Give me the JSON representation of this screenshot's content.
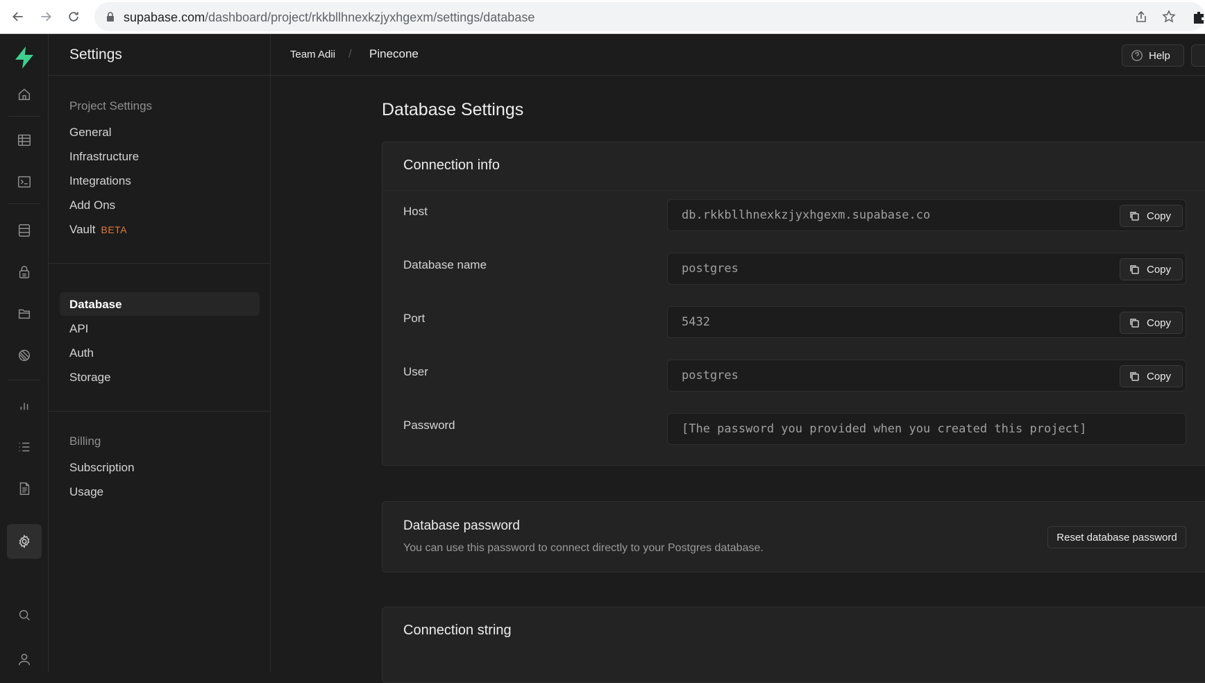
{
  "browser": {
    "url_domain": "supabase.com",
    "url_path": "/dashboard/project/rkkbllhnexkzjyxhgexm/settings/database"
  },
  "header": {
    "section_title": "Settings",
    "breadcrumb_team": "Team Adii",
    "breadcrumb_separator": "/",
    "breadcrumb_project": "Pinecone",
    "help_label": "Help"
  },
  "rail": {
    "items": [
      "home-icon",
      "table-editor-icon",
      "sql-editor-icon",
      "database-icon",
      "auth-icon",
      "storage-icon",
      "edge-functions-icon",
      "reports-icon",
      "logs-icon",
      "api-docs-icon",
      "settings-icon",
      "search-icon",
      "user-icon"
    ],
    "brand_color": "#3ecf8e"
  },
  "menu": {
    "project_settings_title": "Project Settings",
    "project_items": [
      {
        "label": "General"
      },
      {
        "label": "Infrastructure"
      },
      {
        "label": "Integrations"
      },
      {
        "label": "Add Ons"
      },
      {
        "label": "Vault",
        "badge": "BETA"
      }
    ],
    "config_items": [
      {
        "label": "Database",
        "active": true
      },
      {
        "label": "API"
      },
      {
        "label": "Auth"
      },
      {
        "label": "Storage"
      }
    ],
    "billing_title": "Billing",
    "billing_items": [
      {
        "label": "Subscription"
      },
      {
        "label": "Usage"
      }
    ]
  },
  "main": {
    "page_title": "Database Settings",
    "connection_info": {
      "title": "Connection info",
      "copy_label": "Copy",
      "fields": [
        {
          "label": "Host",
          "value": "db.rkkbllhnexkzjyxhgexm.supabase.co"
        },
        {
          "label": "Database name",
          "value": "postgres"
        },
        {
          "label": "Port",
          "value": "5432"
        },
        {
          "label": "User",
          "value": "postgres"
        },
        {
          "label": "Password",
          "value": "[The password you provided when you created this project]"
        }
      ]
    },
    "database_password": {
      "title": "Database password",
      "description": "You can use this password to connect directly to your Postgres database.",
      "reset_label": "Reset database password"
    },
    "connection_string": {
      "title": "Connection string"
    }
  }
}
